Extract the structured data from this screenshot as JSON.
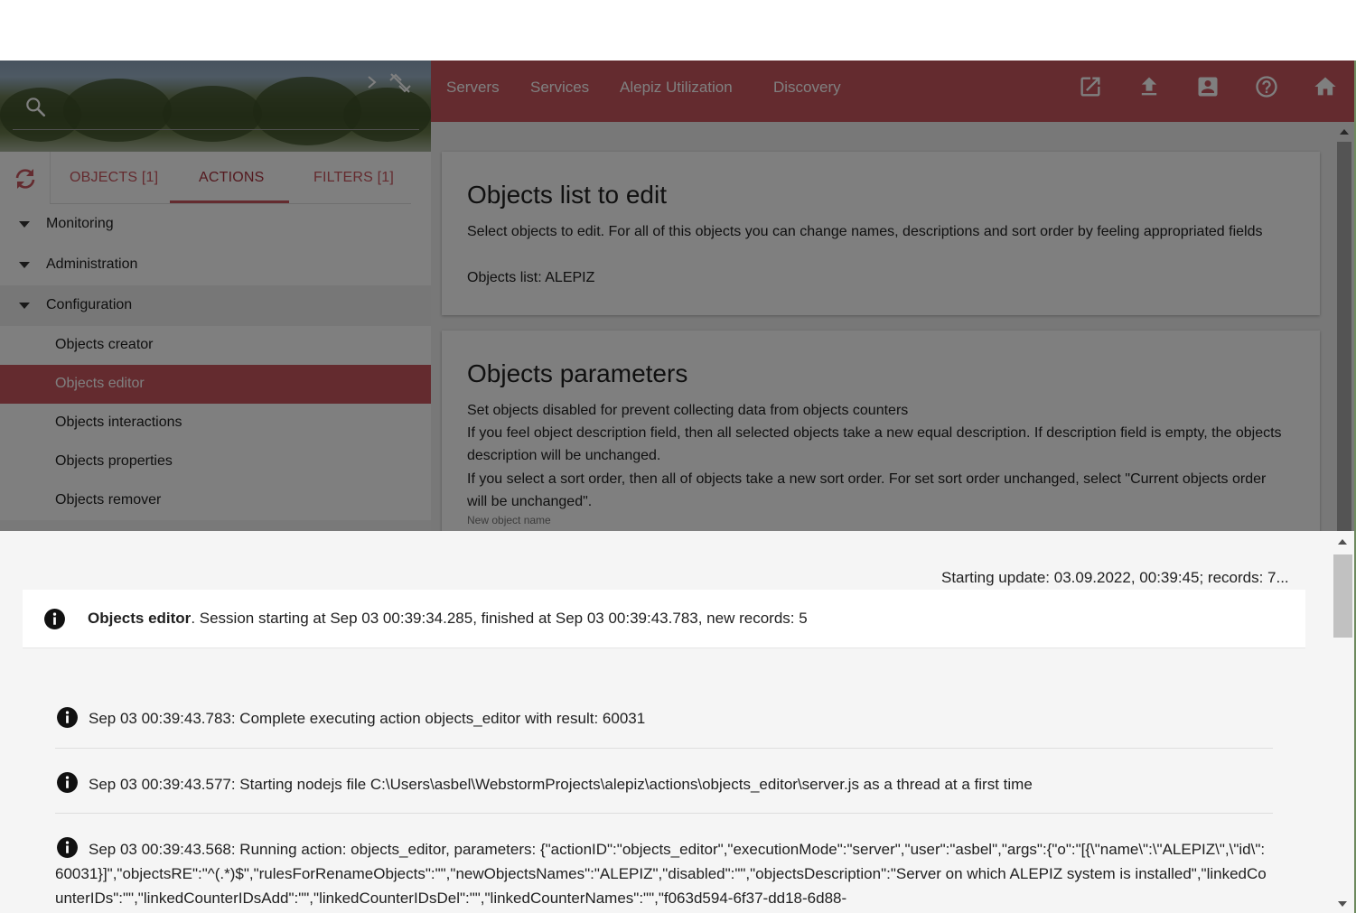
{
  "sidebar": {
    "tabs": [
      {
        "label": "OBJECTS [1]"
      },
      {
        "label": "ACTIONS"
      },
      {
        "label": "FILTERS [1]"
      }
    ],
    "groups": [
      {
        "label": "Monitoring"
      },
      {
        "label": "Administration"
      },
      {
        "label": "Configuration"
      }
    ],
    "items": [
      {
        "label": "Objects creator"
      },
      {
        "label": "Objects editor"
      },
      {
        "label": "Objects interactions"
      },
      {
        "label": "Objects properties"
      },
      {
        "label": "Objects remover"
      }
    ]
  },
  "navbar": {
    "links": [
      {
        "label": "Servers"
      },
      {
        "label": "Services"
      },
      {
        "label": "Alepiz Utilization"
      },
      {
        "label": "Discovery"
      }
    ],
    "icons": [
      "open-in-new-icon",
      "upload-icon",
      "account-box-icon",
      "help-icon",
      "home-icon"
    ]
  },
  "main": {
    "card1": {
      "title": "Objects list to edit",
      "text": "Select objects to edit. For all of this objects you can change names, descriptions and sort order by feeling appropriated fields",
      "list": "Objects list: ALEPIZ"
    },
    "card2": {
      "title": "Objects parameters",
      "line1": "Set objects disabled for prevent collecting data from objects counters",
      "line2": "If you feel object description field, then all selected objects take a new equal description. If description field is empty, the objects description will be unchanged.",
      "line3": "If you select a sort order, then all of objects take a new sort order. For set sort order unchanged, select \"Current objects order will be unchanged\".",
      "field_label": "New object name"
    }
  },
  "log": {
    "status": "Starting update: 03.09.2022, 00:39:45; records: 7...",
    "session": {
      "name": "Objects editor",
      "text": ". Session starting at Sep 03 00:39:34.285, finished at Sep 03 00:39:43.783, new records: 5"
    },
    "entries": [
      {
        "text": "Sep 03 00:39:43.783:  Complete executing action objects_editor with result: 60031"
      },
      {
        "text": "Sep 03 00:39:43.577:  Starting nodejs file C:\\Users\\asbel\\WebstormProjects\\alepiz\\actions\\objects_editor\\server.js as a thread at a first time"
      },
      {
        "text": "Sep 03 00:39:43.568:  Running action: objects_editor, parameters: {\"actionID\":\"objects_editor\",\"executionMode\":\"server\",\"user\":\"asbel\",\"args\":{\"o\":\"[{\\\"name\\\":\\\"ALEPIZ\\\",\\\"id\\\":60031}]\",\"objectsRE\":\"^(.*)$\",\"rulesForRenameObjects\":\"\",\"newObjectsNames\":\"ALEPIZ\",\"disabled\":\"\",\"objectsDescription\":\"Server on which ALEPIZ system is installed\",\"linkedCounterIDs\":\"\",\"linkedCounterIDsAdd\":\"\",\"linkedCounterIDsDel\":\"\",\"linkedCounterNames\":\"\",\"f063d594-6f37-dd18-6d88-"
      }
    ]
  },
  "colors": {
    "accent": "#c9565f",
    "accent_dark": "#a8323e"
  }
}
